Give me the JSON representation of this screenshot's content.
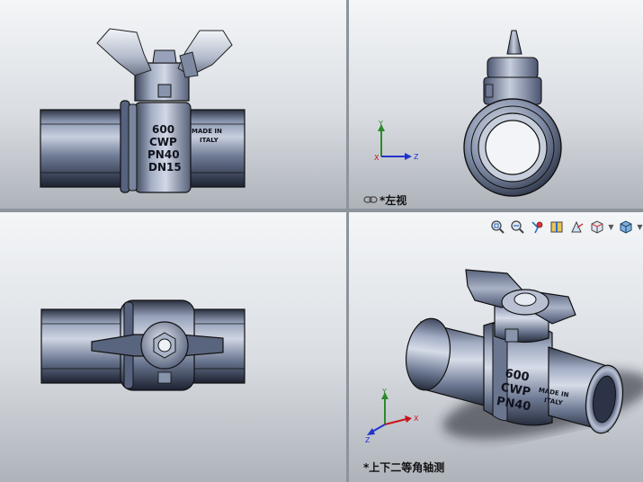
{
  "views": {
    "front": {
      "label": ""
    },
    "left": {
      "label": "*左视"
    },
    "top": {
      "label": ""
    },
    "iso": {
      "label": "*上下二等角轴测"
    }
  },
  "part": {
    "marking_lines": [
      "600",
      "CWP",
      "PN40",
      "DN15"
    ],
    "origin_lines": [
      "MADE IN",
      "ITALY"
    ]
  },
  "triad": {
    "x": "X",
    "y": "Y",
    "z": "Z"
  },
  "toolbar": {
    "items": [
      {
        "name": "zoom-to-fit",
        "icon": "zoom-fit-icon"
      },
      {
        "name": "zoom-to-area",
        "icon": "zoom-area-icon"
      },
      {
        "name": "previous-view",
        "icon": "previous-view-icon"
      },
      {
        "name": "section-view",
        "icon": "section-view-icon"
      },
      {
        "name": "dynamic-annotation",
        "icon": "annotation-icon"
      },
      {
        "name": "view-orientation",
        "icon": "view-orientation-icon"
      },
      {
        "name": "display-style",
        "icon": "display-style-icon"
      }
    ]
  },
  "colors": {
    "metal": "#6c7a96",
    "metal_light": "#b9c2d6",
    "metal_dark": "#1d2230",
    "triad_x": "#c8141e",
    "triad_y": "#2c8a2c",
    "triad_z": "#2233cc"
  }
}
